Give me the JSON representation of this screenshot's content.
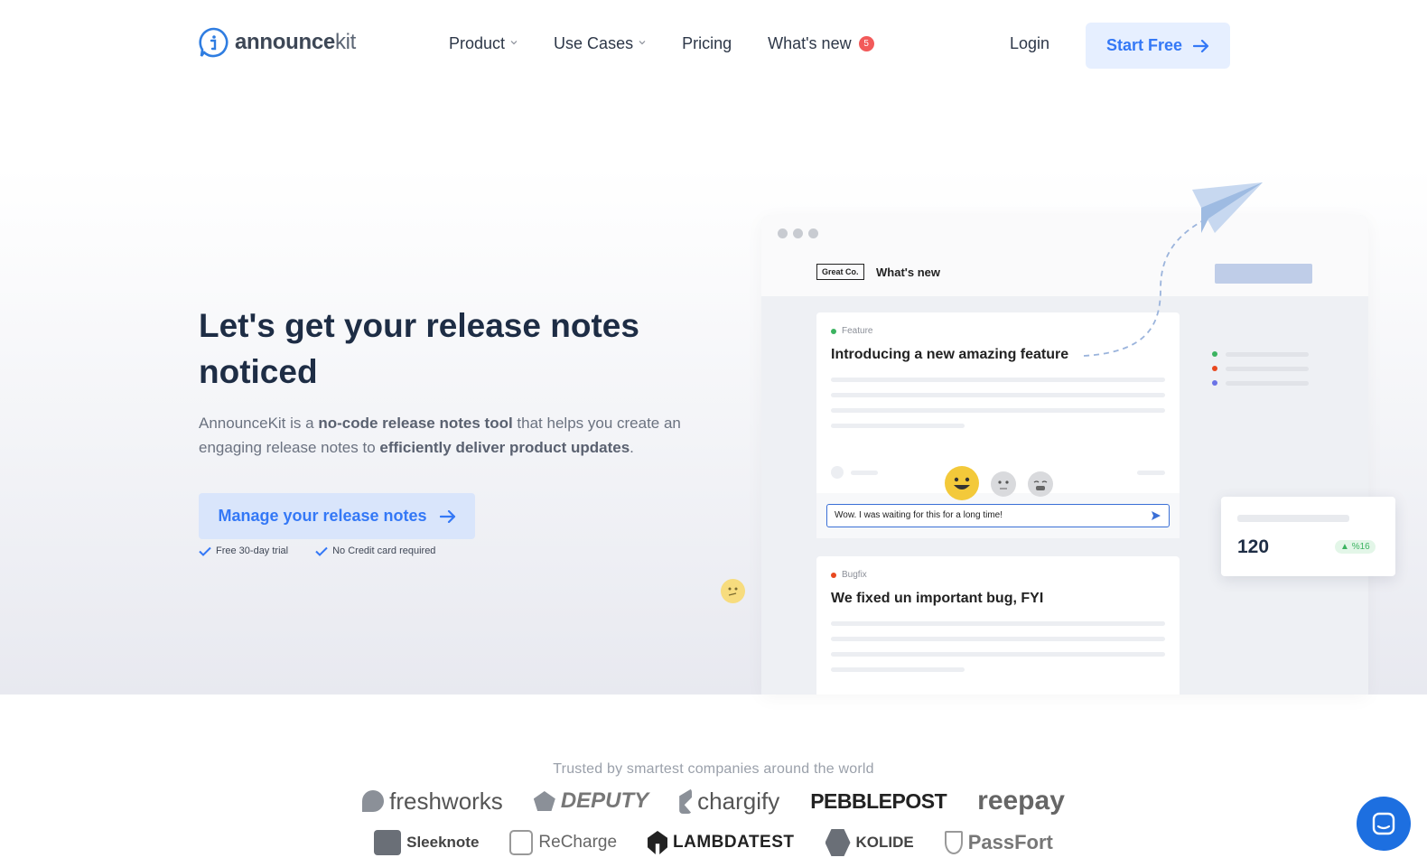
{
  "nav": {
    "brand": "announcekit",
    "brand_part1": "announce",
    "brand_part2": "kit",
    "items": [
      {
        "label": "Product",
        "has_dropdown": true
      },
      {
        "label": "Use Cases",
        "has_dropdown": true
      },
      {
        "label": "Pricing",
        "has_dropdown": false
      },
      {
        "label": "What's new",
        "has_dropdown": false
      }
    ],
    "whats_new_badge": "5",
    "login": "Login",
    "start_free": "Start Free"
  },
  "hero": {
    "title": "Let's get your release notes noticed",
    "desc_1": "AnnounceKit is a ",
    "desc_b1": "no-code release notes tool",
    "desc_2": " that helps you create an engaging release notes to ",
    "desc_b2": "efficiently deliver product updates",
    "desc_3": ".",
    "cta": "Manage your release notes",
    "check_1": "Free 30-day trial",
    "check_2": "No Credit card required"
  },
  "mockup": {
    "brand_box": "Great Co.",
    "header": "What's new",
    "post1_tag": "Feature",
    "post1_title": "Introducing a new amazing feature",
    "reply_text": "Wow. I was waiting for this for a long time!",
    "post2_tag": "Bugfix",
    "post2_title": "We fixed un important bug, FYI",
    "stat_value": "120",
    "stat_change": "%16"
  },
  "trusted": {
    "heading": "Trusted by smartest companies around the world",
    "row1": [
      "freshworks",
      "DEPUTY",
      "chargify",
      "PEBBLEPOST",
      "reepay"
    ],
    "row2": [
      "Sleeknote",
      "ReCharge",
      "LAMBDATEST",
      "KOLIDE",
      "PassFort"
    ]
  },
  "colors": {
    "accent": "#3478f6",
    "badge": "#f25a5a",
    "feature_dot": "#3bb360",
    "bugfix_dot": "#e8481f",
    "chat": "#1d6fe0"
  },
  "icons": [
    "logo-icon",
    "chevron-down-icon",
    "arrow-right-icon",
    "check-icon",
    "send-icon",
    "chat-icon",
    "paper-plane-icon"
  ]
}
